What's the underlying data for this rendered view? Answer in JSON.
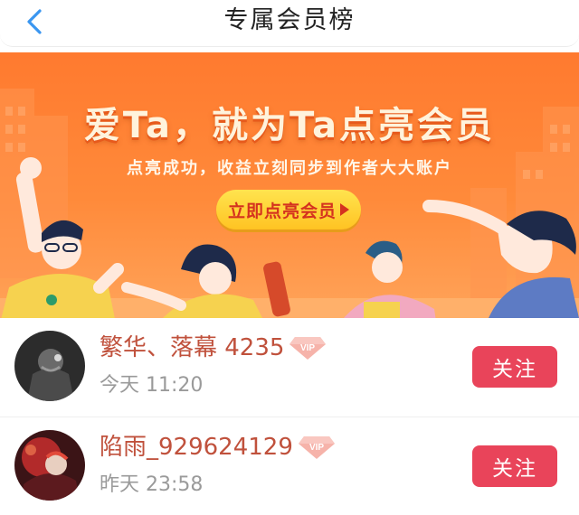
{
  "header": {
    "title": "专属会员榜",
    "back_icon": "chevron-left-icon"
  },
  "banner": {
    "headline": "爱Ta，就为Ta点亮会员",
    "subtitle": "点亮成功，收益立刻同步到作者大大账户",
    "cta_label": "立即点亮会员",
    "cta_icon": "play-arrow-icon"
  },
  "members": [
    {
      "name": "繁华、落幕 4235",
      "badge": "VIP",
      "time": "今天 11:20",
      "follow_label": "关注",
      "avatar_icon": "avatar-dark"
    },
    {
      "name": "陷雨_929624129",
      "badge": "VIP",
      "time": "昨天 23:58",
      "follow_label": "关注",
      "avatar_icon": "avatar-red"
    }
  ],
  "colors": {
    "accent": "#e9445a",
    "banner_orange": "#ff7a2f",
    "cta_yellow": "#ffd23a",
    "name_color": "#c0513c",
    "back_blue": "#3a96f0"
  }
}
